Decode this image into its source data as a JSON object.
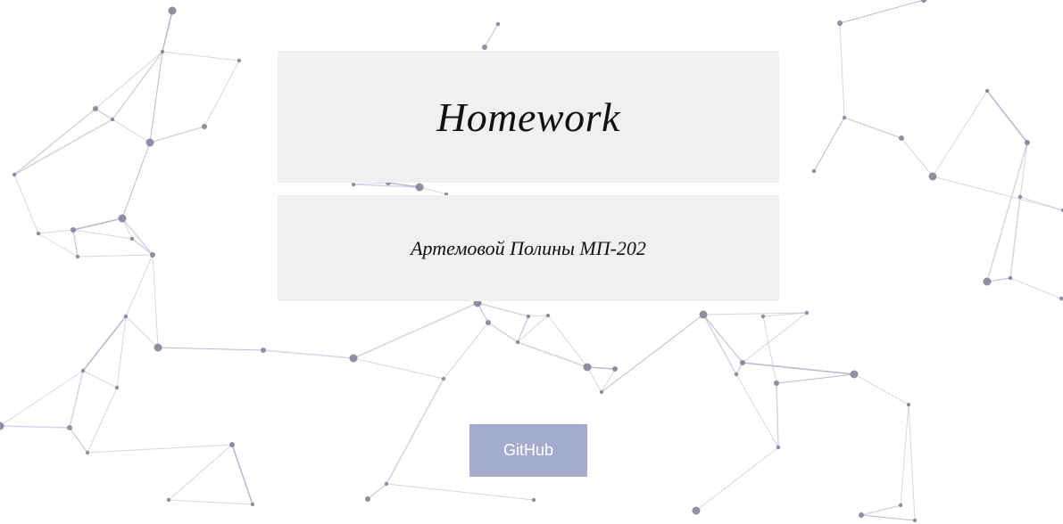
{
  "header": {
    "title": "Homework"
  },
  "author": {
    "subtitle": "Артемовой Полины МП-202"
  },
  "actions": {
    "github_label": "GitHub"
  },
  "colors": {
    "background": "#ffffff",
    "card_background": "#f0f0f0",
    "button_background": "#a3acce",
    "button_text": "#ffffff",
    "network_line": "#a99fc4",
    "network_node": "#878397"
  }
}
